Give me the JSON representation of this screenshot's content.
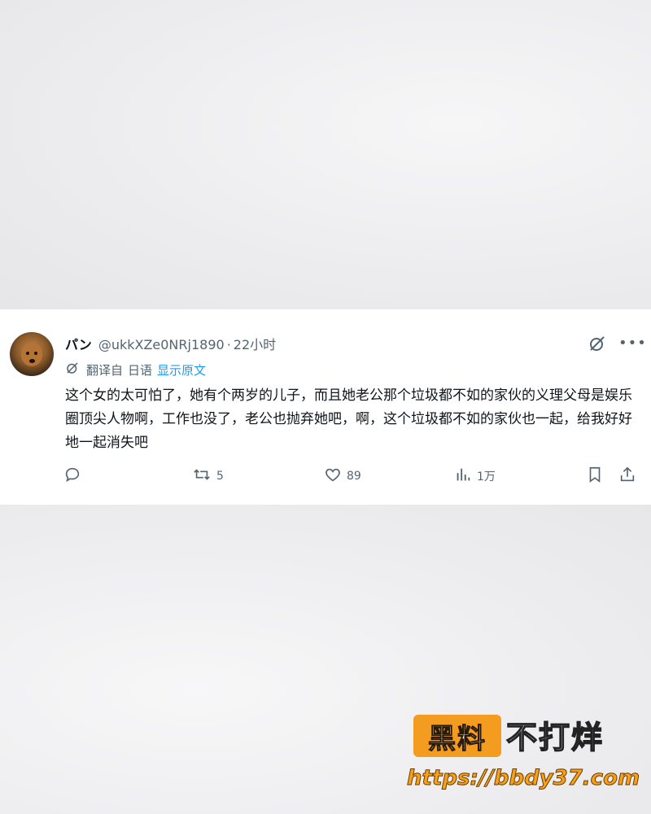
{
  "tweet": {
    "author_name": "パン",
    "author_handle": "@ukkXZe0NRj1890",
    "separator": "·",
    "time": "22小时",
    "translation": {
      "label": "翻译自",
      "language": "日语",
      "show_original": "显示原文"
    },
    "text": "这个女的太可怕了，她有个两岁的儿子，而且她老公那个垃圾都不如的家伙的义理父母是娱乐圈顶尖人物啊，工作也没了，老公也抛弃她吧，啊，这个垃圾都不如的家伙也一起，给我好好地一起消失吧",
    "actions": {
      "reply_count": "",
      "retweet_count": "5",
      "like_count": "89",
      "view_count": "1万"
    }
  },
  "icons": [
    "avatar",
    "grok-icon",
    "more-icon",
    "translate-icon",
    "reply-icon",
    "retweet-icon",
    "like-icon",
    "views-icon",
    "bookmark-icon",
    "share-icon"
  ],
  "colors": {
    "accent": "#1d9bf0",
    "text": "#0f1419",
    "muted": "#536471",
    "watermark_orange": "#f39c1f"
  },
  "watermark": {
    "logo": "黑料",
    "brand": "不打烊",
    "url": "https://bbdy37.com"
  }
}
